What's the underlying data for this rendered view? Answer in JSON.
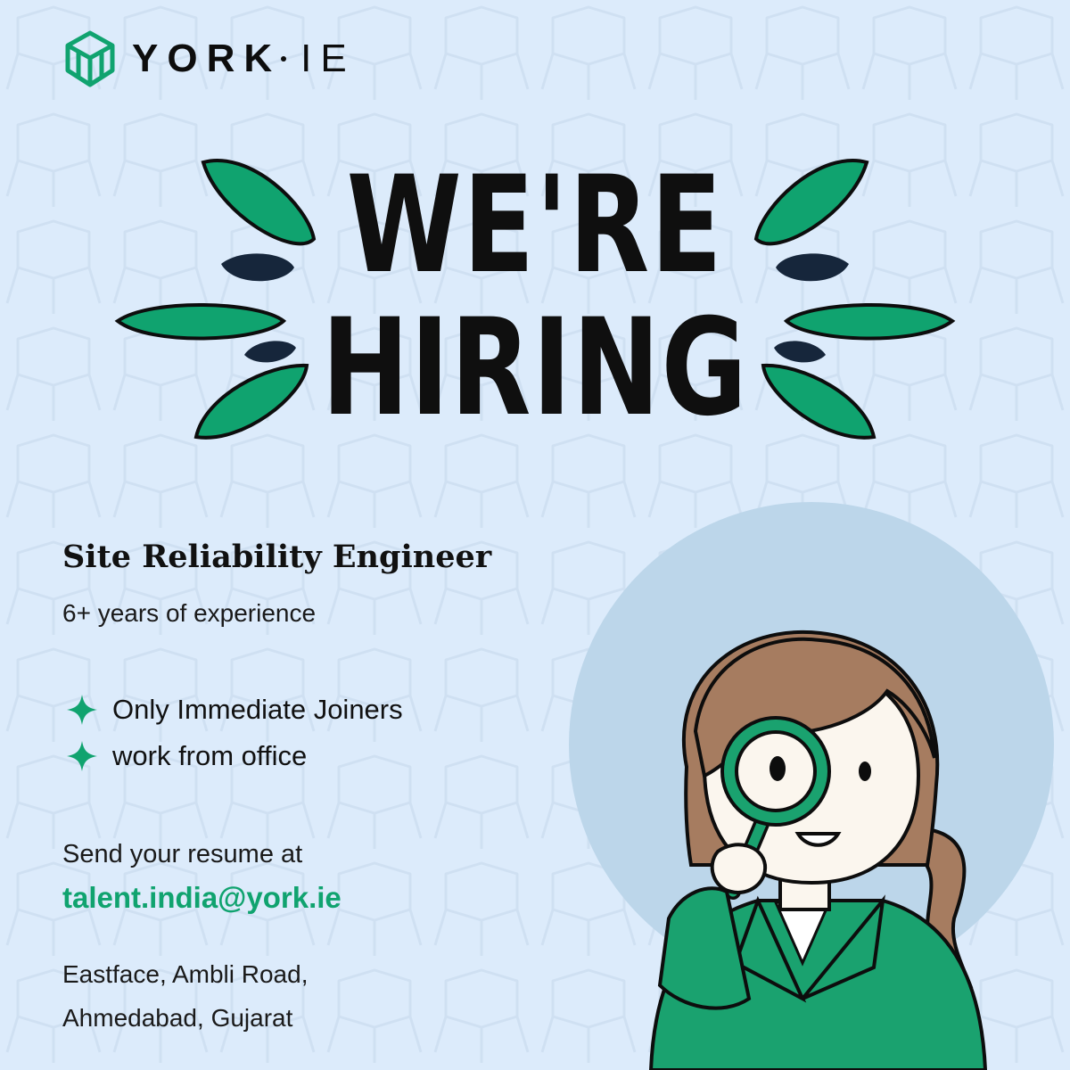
{
  "brand": {
    "name": "YORK",
    "suffix": "IE",
    "colors": {
      "green": "#10a36f",
      "navy": "#16263b",
      "background": "#dcebfb",
      "circle": "#bcd6ea",
      "hair": "#a67c60"
    }
  },
  "headline": {
    "line1": "WE'RE",
    "line2": "HIRING"
  },
  "job": {
    "title": "Site Reliability Engineer",
    "experience": "6+ years of experience",
    "bullets": [
      {
        "icon": "sparkle-icon",
        "text": "Only Immediate Joiners"
      },
      {
        "icon": "sparkle-icon",
        "text": "work from office"
      }
    ]
  },
  "contact": {
    "label": "Send your resume at",
    "email": "talent.india@york.ie"
  },
  "address": {
    "line1": "Eastface, Ambli Road,",
    "line2": "Ahmedabad, Gujarat"
  },
  "icons": [
    "york-logo-icon",
    "sparkle-icon",
    "woman-with-magnifier-illustration"
  ]
}
